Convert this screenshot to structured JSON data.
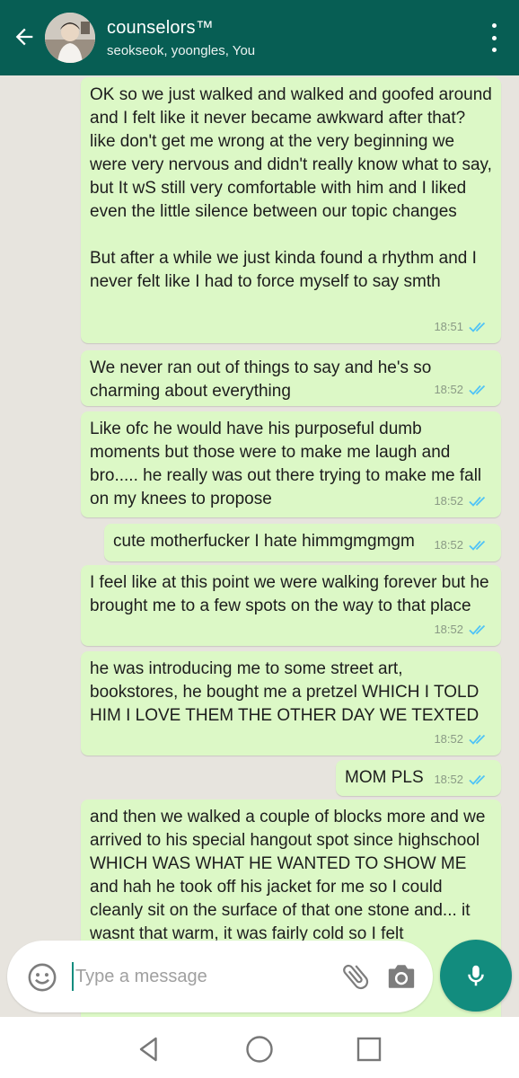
{
  "header": {
    "title": "counselors™",
    "subtitle": "seokseok, yoongles, You"
  },
  "messages": [
    {
      "text": "OK so we just walked and walked and goofed around and I felt like it never became awkward after that? like don't get me wrong at the very beginning we were very nervous and didn't really know what to say, but It wS still very comfortable with him and I liked even the little silence between our topic changes\n\nBut after a while we just kinda found a rhythm and I never felt like I had to force myself to say smth",
      "time": "18:51"
    },
    {
      "text": "We never ran out of things to say and he's so charming about everything",
      "time": "18:52"
    },
    {
      "text": "Like ofc he would have his purposeful dumb moments but those were to make me laugh and bro..... he really was out there trying to make me fall on my knees to propose",
      "time": "18:52"
    },
    {
      "text": "cute motherfucker I hate himmgmgmgm",
      "time": "18:52"
    },
    {
      "text": "I feel like at this point we were walking forever but he brought me to a few spots on the way to that place",
      "time": "18:52"
    },
    {
      "text": "he was introducing me to some street art, bookstores, he bought me a pretzel WHICH I TOLD HIM I LOVE THEM THE OTHER DAY WE TEXTED",
      "time": "18:52"
    },
    {
      "text": "MOM PLS",
      "time": "18:52"
    },
    {
      "text": "and then we walked a couple of blocks more and we arrived to his special hangout spot since highschool WHICH WAS WHAT HE WANTED TO SHOW ME and hah he took off his jacket for me so I could cleanly sit on the surface of that one stone and... it wasnt that warm, it was fairly cold so I felt",
      "time": ""
    }
  ],
  "composer": {
    "placeholder": "Type a message"
  },
  "icons": {
    "back": "arrow-left-icon",
    "menu": "more-vertical-icon",
    "emoji": "emoji-icon",
    "attach": "paperclip-icon",
    "camera": "camera-icon",
    "mic": "microphone-icon",
    "scroll": "double-chevron-down-icon",
    "read": "double-check-icon"
  },
  "colors": {
    "header": "#075e54",
    "accent": "#128c7e",
    "bubble_out": "#dcf8c6",
    "chat_bg": "#e7e4de",
    "read_ticks": "#4fc3f7"
  }
}
